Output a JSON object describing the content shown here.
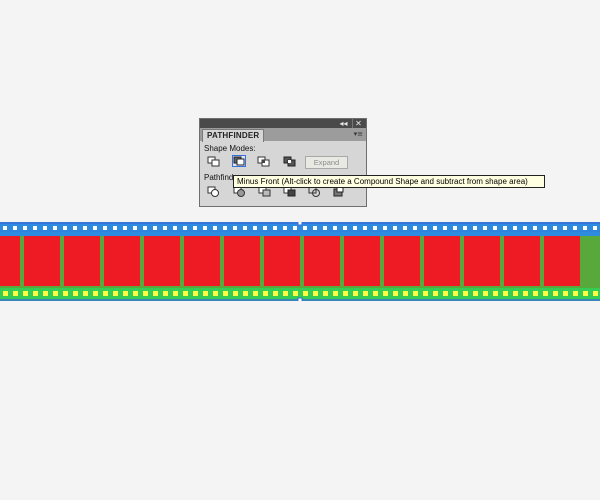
{
  "panel": {
    "title": "PATHFINDER",
    "collapse_glyph": "◂◂",
    "close_glyph": "✕",
    "menu_glyph": "▾≡",
    "shape_modes_label": "Shape Modes:",
    "pathfinders_label": "Pathfinde",
    "expand_label": "Expand",
    "shape_mode_icons": [
      "unite-icon",
      "minus-front-icon",
      "intersect-icon",
      "exclude-icon"
    ],
    "pathfinder_icons": [
      "divide-icon",
      "trim-icon",
      "merge-icon",
      "crop-icon",
      "outline-icon",
      "minus-back-icon"
    ]
  },
  "tooltip": {
    "text": "Minus Front (Alt-click to create a Compound Shape and subtract from shape area)"
  },
  "film_strip": {
    "frame_count": 15,
    "colors": {
      "frame_fill": "#ee1b24",
      "film_base": "#59a83c",
      "top_band": "#2d8be0",
      "bottom_band": "#33cc55",
      "top_perforation": "#ffffff",
      "bottom_perforation": "#ffff44",
      "selection": "#3a6fd9"
    }
  }
}
